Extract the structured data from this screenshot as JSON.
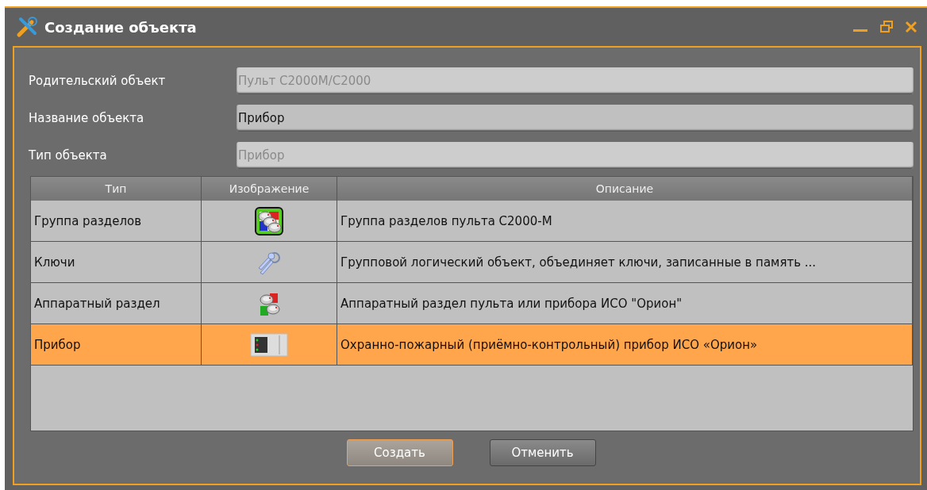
{
  "window": {
    "title": "Создание объекта"
  },
  "fields": [
    {
      "label": "Родительский объект",
      "value": "Пульт С2000М/С2000",
      "disabled": true
    },
    {
      "label": "Название объекта",
      "value": "Прибор",
      "disabled": false
    },
    {
      "label": "Тип объекта",
      "value": "Прибор",
      "disabled": true
    }
  ],
  "table": {
    "columns": [
      "Тип",
      "Изображение",
      "Описание"
    ],
    "rows": [
      {
        "type": "Группа разделов",
        "description": "Группа разделов пульта С2000-М",
        "selected": false
      },
      {
        "type": "Ключи",
        "description": "Групповой логический объект, объединяет ключи, записанные в память ...",
        "selected": false
      },
      {
        "type": "Аппаратный раздел",
        "description": "Аппаратный раздел пульта или прибора ИСО \"Орион\"",
        "selected": false
      },
      {
        "type": "Прибор",
        "description": "Охранно-пожарный (приёмно-контрольный) прибор ИСО «Орион»",
        "selected": true
      }
    ]
  },
  "buttons": [
    {
      "label": "Создать",
      "default": true
    },
    {
      "label": "Отменить",
      "default": false
    }
  ]
}
